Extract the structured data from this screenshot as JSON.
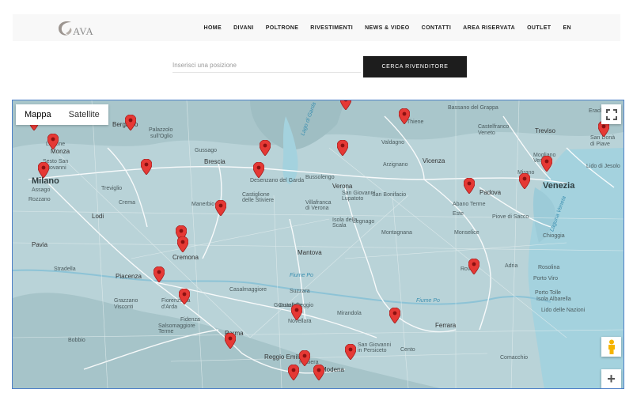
{
  "header": {
    "logo_text": "AVA",
    "nav": [
      "HOME",
      "DIVANI",
      "POLTRONE",
      "RIVESTIMENTI",
      "NEWS & VIDEO",
      "CONTATTI",
      "AREA RISERVATA",
      "OUTLET",
      "EN"
    ]
  },
  "search": {
    "placeholder": "Inserisci una posizione",
    "button_label": "CERCA RIVENDITORE"
  },
  "map": {
    "type_controls": [
      "Mappa",
      "Satellite"
    ],
    "active_type": "Mappa",
    "zoom_in_label": "+",
    "places": [
      {
        "name": "Bergamo",
        "cls": "medium"
      },
      {
        "name": "Lissone",
        "cls": ""
      },
      {
        "name": "Monza",
        "cls": "medium"
      },
      {
        "name": "Sesto San",
        "cls": ""
      },
      {
        "name": "Giovanni",
        "cls": ""
      },
      {
        "name": "Milano",
        "cls": "major"
      },
      {
        "name": "Assago",
        "cls": ""
      },
      {
        "name": "Rozzano",
        "cls": ""
      },
      {
        "name": "Treviglio",
        "cls": ""
      },
      {
        "name": "Palazzolo",
        "cls": ""
      },
      {
        "name": "sull'Oglio",
        "cls": ""
      },
      {
        "name": "Gussago",
        "cls": ""
      },
      {
        "name": "Brescia",
        "cls": "medium"
      },
      {
        "name": "Crema",
        "cls": ""
      },
      {
        "name": "Lodi",
        "cls": "medium"
      },
      {
        "name": "Pavia",
        "cls": "medium"
      },
      {
        "name": "Manerbio",
        "cls": ""
      },
      {
        "name": "Castiglione",
        "cls": ""
      },
      {
        "name": "delle Stiviere",
        "cls": ""
      },
      {
        "name": "Cremona",
        "cls": "medium"
      },
      {
        "name": "Stradella",
        "cls": ""
      },
      {
        "name": "Piacenza",
        "cls": "medium"
      },
      {
        "name": "Fiorenzuola",
        "cls": ""
      },
      {
        "name": "d'Arda",
        "cls": ""
      },
      {
        "name": "Grazzano",
        "cls": ""
      },
      {
        "name": "Visconti",
        "cls": ""
      },
      {
        "name": "Fidenza",
        "cls": ""
      },
      {
        "name": "Salsomaggiore",
        "cls": ""
      },
      {
        "name": "Terme",
        "cls": ""
      },
      {
        "name": "Bobbio",
        "cls": ""
      },
      {
        "name": "Parma",
        "cls": "medium"
      },
      {
        "name": "Casalmaggiore",
        "cls": ""
      },
      {
        "name": "Guastalla",
        "cls": ""
      },
      {
        "name": "Reggio",
        "cls": ""
      },
      {
        "name": "Novellara",
        "cls": ""
      },
      {
        "name": "Reggio Emilia",
        "cls": "medium"
      },
      {
        "name": "Rubiera",
        "cls": ""
      },
      {
        "name": "Modena",
        "cls": "medium"
      },
      {
        "name": "Mantova",
        "cls": "medium"
      },
      {
        "name": "Suzzara",
        "cls": ""
      },
      {
        "name": "Mirandola",
        "cls": ""
      },
      {
        "name": "Ferrara",
        "cls": "medium"
      },
      {
        "name": "San Giovanni",
        "cls": ""
      },
      {
        "name": "in Persiceto",
        "cls": ""
      },
      {
        "name": "Cento",
        "cls": ""
      },
      {
        "name": "Comacchio",
        "cls": ""
      },
      {
        "name": "Fiume Po",
        "cls": "water"
      },
      {
        "name": "Lago di Garda",
        "cls": "water"
      },
      {
        "name": "Desenzano del Garda",
        "cls": ""
      },
      {
        "name": "Bussolengo",
        "cls": ""
      },
      {
        "name": "Verona",
        "cls": "medium"
      },
      {
        "name": "San Giovanni",
        "cls": ""
      },
      {
        "name": "Lupatoto",
        "cls": ""
      },
      {
        "name": "San Bonifacio",
        "cls": ""
      },
      {
        "name": "Villafranca",
        "cls": ""
      },
      {
        "name": "di Verona",
        "cls": ""
      },
      {
        "name": "Isola della",
        "cls": ""
      },
      {
        "name": "Scala",
        "cls": ""
      },
      {
        "name": "Legnago",
        "cls": ""
      },
      {
        "name": "Montagnana",
        "cls": ""
      },
      {
        "name": "Este",
        "cls": ""
      },
      {
        "name": "Monselice",
        "cls": ""
      },
      {
        "name": "Valdagno",
        "cls": ""
      },
      {
        "name": "Thiene",
        "cls": ""
      },
      {
        "name": "Arzignano",
        "cls": ""
      },
      {
        "name": "Vicenza",
        "cls": "medium"
      },
      {
        "name": "Bassano del Grappa",
        "cls": ""
      },
      {
        "name": "Castelfranco",
        "cls": ""
      },
      {
        "name": "Veneto",
        "cls": ""
      },
      {
        "name": "Treviso",
        "cls": "medium"
      },
      {
        "name": "Mogliano",
        "cls": ""
      },
      {
        "name": "Veneto",
        "cls": ""
      },
      {
        "name": "Mirano",
        "cls": ""
      },
      {
        "name": "Padova",
        "cls": "medium"
      },
      {
        "name": "Abano Terme",
        "cls": ""
      },
      {
        "name": "Piove di Sacco",
        "cls": ""
      },
      {
        "name": "Venezia",
        "cls": "major"
      },
      {
        "name": "Chioggia",
        "cls": ""
      },
      {
        "name": "Rovigo",
        "cls": ""
      },
      {
        "name": "Adria",
        "cls": ""
      },
      {
        "name": "Rosolina",
        "cls": ""
      },
      {
        "name": "Porto Viro",
        "cls": ""
      },
      {
        "name": "Porto Tolle",
        "cls": ""
      },
      {
        "name": "Isola Albarella",
        "cls": ""
      },
      {
        "name": "Lido di Jesolo",
        "cls": ""
      },
      {
        "name": "San Donà",
        "cls": ""
      },
      {
        "name": "di Piave",
        "cls": ""
      },
      {
        "name": "Eraclea",
        "cls": ""
      },
      {
        "name": "Laguna Veneta",
        "cls": "water"
      },
      {
        "name": "Lido delle Nazioni",
        "cls": ""
      },
      {
        "name": "Fiume Po",
        "cls": "water"
      },
      {
        "name": "Guastalla",
        "cls": ""
      }
    ]
  }
}
